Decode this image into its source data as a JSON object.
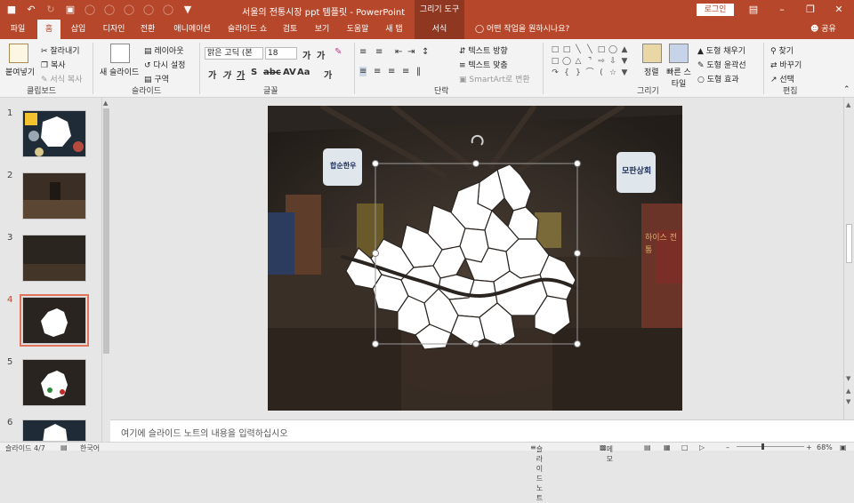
{
  "titlebar": {
    "title": "서울의 전통시장 ppt 템플릿  -  PowerPoint",
    "context_group": "그리기 도구",
    "login": "로그인",
    "accent": "#b7472a"
  },
  "tabs": [
    "파일",
    "홈",
    "삽입",
    "디자인",
    "전환",
    "애니메이션",
    "슬라이드 쇼",
    "검토",
    "보기",
    "도움말",
    "새 탭",
    "서식"
  ],
  "tell_me": "어떤 작업을 원하시나요?",
  "share": "공유",
  "ribbon": {
    "clipboard": {
      "paste": "붙여넣기",
      "cut": "잘라내기",
      "copy": "복사",
      "format_painter": "서식 복사",
      "label": "클립보드"
    },
    "slides": {
      "new_slide": "새 슬라이드",
      "layout": "레이아웃",
      "reset": "다시 설정",
      "section": "구역",
      "label": "슬라이드"
    },
    "font": {
      "name": "맑은 고딕 (본",
      "size": "18",
      "label": "글꼴"
    },
    "paragraph": {
      "text_direction": "텍스트 방향",
      "align_text": "텍스트 맞춤",
      "smartart": "SmartArt로 변환",
      "label": "단락"
    },
    "drawing": {
      "arrange": "정렬",
      "quick_styles": "빠른 스타일",
      "shape_fill": "도형 채우기",
      "shape_outline": "도형 윤곽선",
      "shape_effects": "도형 효과",
      "label": "그리기"
    },
    "editing": {
      "find": "찾기",
      "replace": "바꾸기",
      "select": "선택",
      "label": "편집"
    }
  },
  "thumbnails": [
    "1",
    "2",
    "3",
    "4",
    "5",
    "6"
  ],
  "slide": {
    "sign_left": "합순한우",
    "sign_right": "모판상회",
    "sign_mid": "하이스 전통"
  },
  "notes_placeholder": "여기에 슬라이드 노트의 내용을 입력하십시오",
  "status": {
    "slide_counter": "슬라이드 4/7",
    "language": "한국어",
    "notes": "슬라이드 노트",
    "comments": "메모",
    "zoom": "68%"
  }
}
